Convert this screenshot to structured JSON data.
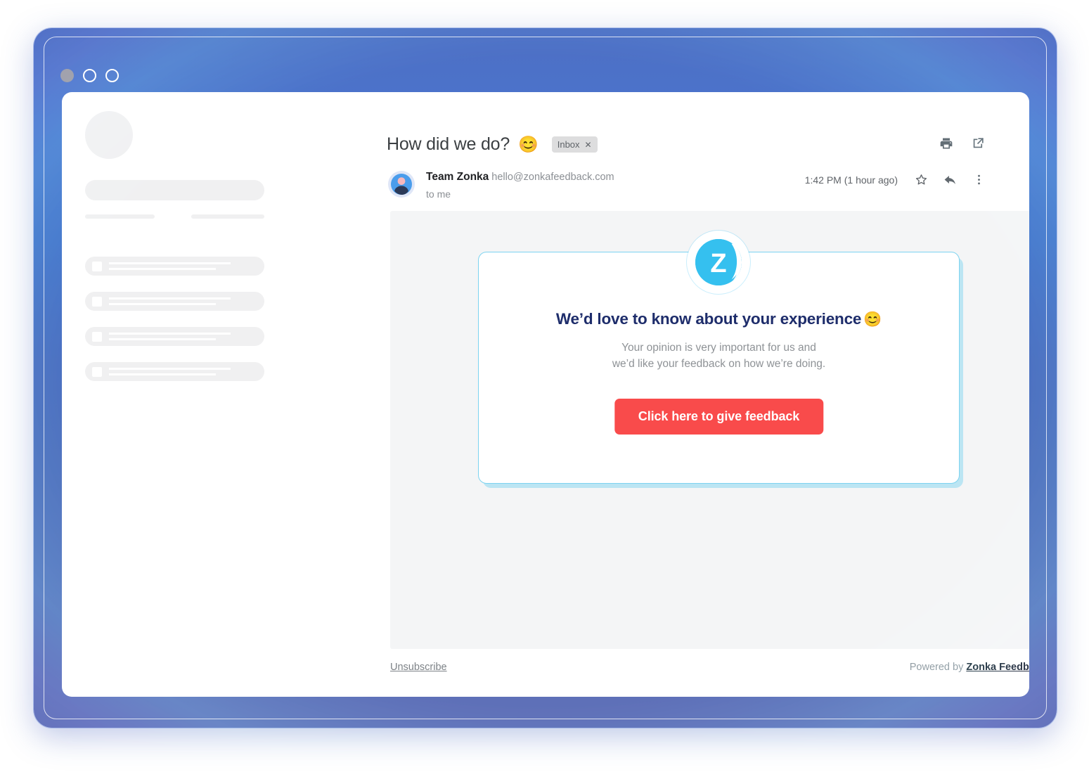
{
  "window": {
    "dots": [
      "minimize-dot",
      "maximize-dot",
      "close-dot"
    ]
  },
  "sidebar": {
    "skeleton_rows": 4
  },
  "email": {
    "subject": "How did we do?",
    "subject_emoji": "😊",
    "label_tag": "Inbox",
    "label_tag_close": "✕",
    "sender_name": "Team Zonka",
    "sender_email": "hello@zonkafeedback.com",
    "recipient": "to me",
    "timestamp": "1:42 PM (1 hour ago)",
    "header_icons": [
      "print-icon",
      "open-in-new-icon"
    ],
    "message_icons": [
      "star-icon",
      "reply-icon",
      "more-options-icon"
    ]
  },
  "card": {
    "logo_alt": "zonka-logo",
    "heading": "We’d love to know about your experience",
    "heading_emoji": "😊",
    "subtext_line1": "Your opinion is very important for us and",
    "subtext_line2": "we’d like your feedback on how we’re doing.",
    "cta_label": "Click here to give feedback"
  },
  "footer": {
    "unsubscribe": "Unsubscribe",
    "powered_by_prefix": "Powered by ",
    "powered_by_brand": "Zonka Feedback"
  },
  "colors": {
    "cta_red": "#f94b4b",
    "brand_cyan": "#35c0ef",
    "card_border": "#7dd3f0",
    "heading_navy": "#1e2d6b",
    "frame_blue": "#4a72c9",
    "body_gray": "#f4f5f6"
  }
}
